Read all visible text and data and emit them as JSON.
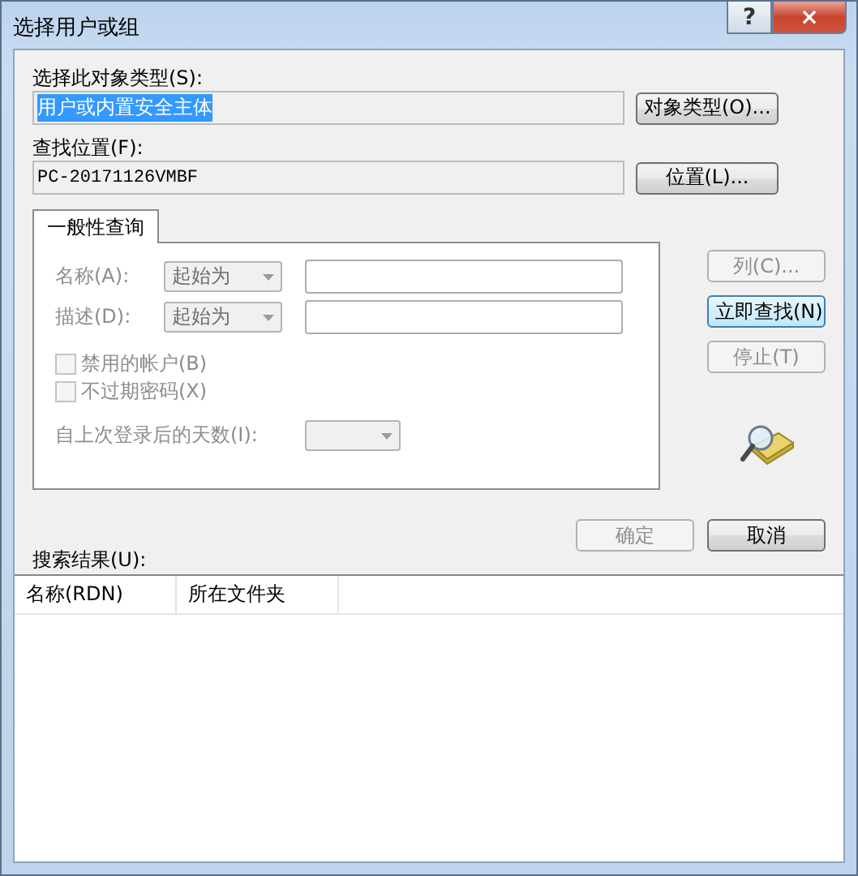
{
  "window": {
    "title": "选择用户或组",
    "help": "?",
    "close": "×"
  },
  "object_type": {
    "label": "选择此对象类型(S):",
    "value": "用户或内置安全主体",
    "value_selected": true,
    "button": "对象类型(O)..."
  },
  "location": {
    "label": "查找位置(F):",
    "value": "PC-20171126VMBF",
    "button": "位置(L)..."
  },
  "tabs": [
    {
      "label": "一般性查询",
      "selected": true
    }
  ],
  "query": {
    "disabled": true,
    "fields": [
      {
        "label": "名称(A):",
        "operator": "起始为"
      },
      {
        "label": "描述(D):",
        "operator": "起始为"
      }
    ],
    "checkboxes": [
      {
        "label": "禁用的帐户(B)",
        "checked": false
      },
      {
        "label": "不过期密码(X)",
        "checked": false
      }
    ],
    "days_label": "自上次登录后的天数(I):"
  },
  "side_buttons": [
    {
      "label": "列(C)...",
      "disabled": true,
      "default": false
    },
    {
      "label": "立即查找(N)",
      "disabled": false,
      "default": true
    },
    {
      "label": "停止(T)",
      "disabled": true,
      "default": false
    }
  ],
  "dialog_buttons": [
    {
      "label": "确定",
      "disabled": true
    },
    {
      "label": "取消",
      "disabled": false
    }
  ],
  "results": {
    "label": "搜索结果(U):",
    "columns": [
      "名称(RDN)",
      "所在文件夹"
    ]
  }
}
